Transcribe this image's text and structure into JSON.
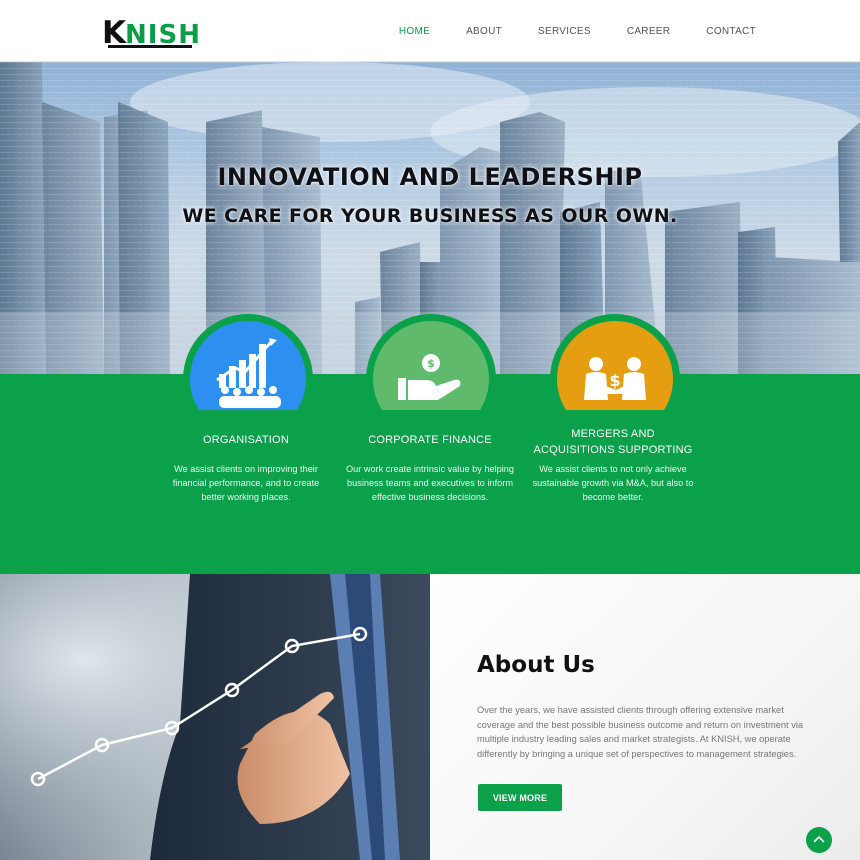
{
  "brand": {
    "logo_k": "K",
    "logo_rest": "NISH"
  },
  "nav": {
    "items": [
      {
        "label": "HOME",
        "active": true
      },
      {
        "label": "ABOUT",
        "active": false
      },
      {
        "label": "SERVICES",
        "active": false
      },
      {
        "label": "CAREER",
        "active": false
      },
      {
        "label": "CONTACT",
        "active": false
      }
    ]
  },
  "hero": {
    "title": "INNOVATION AND LEADERSHIP",
    "subtitle": "WE CARE FOR YOUR BUSINESS AS OUR OWN."
  },
  "services": [
    {
      "title": "ORGANISATION",
      "icon": "team-growth-chart-icon",
      "color": "#2d8ff0",
      "text": "We assist clients on improving their financial performance, and to create better working places."
    },
    {
      "title": "CORPORATE FINANCE",
      "icon": "hand-coin-icon",
      "color": "#5fba6b",
      "text": "Our work create intrinsic value by helping business teams and executives to inform effective business decisions."
    },
    {
      "title": "MERGERS AND ACQUISITIONS SUPPORTING",
      "icon": "dollar-handshake-icon",
      "color": "#e59d12",
      "text": "We assist clients to not only achieve sustainable growth via M&A, but also to become better."
    }
  ],
  "about": {
    "title": "About Us",
    "text": "Over the years, we have assisted clients through offering extensive market coverage and the best possible business outcome and return on investment via multiple industry leading sales and market strategists. At KNISH, we operate differently by bringing a unique set of perspectives to management strategies.",
    "button": "VIEW MORE"
  },
  "colors": {
    "brand_green": "#0aa14a",
    "nav_active": "#0a9d45"
  },
  "scroll_top": {
    "icon": "chevron-up-icon"
  }
}
